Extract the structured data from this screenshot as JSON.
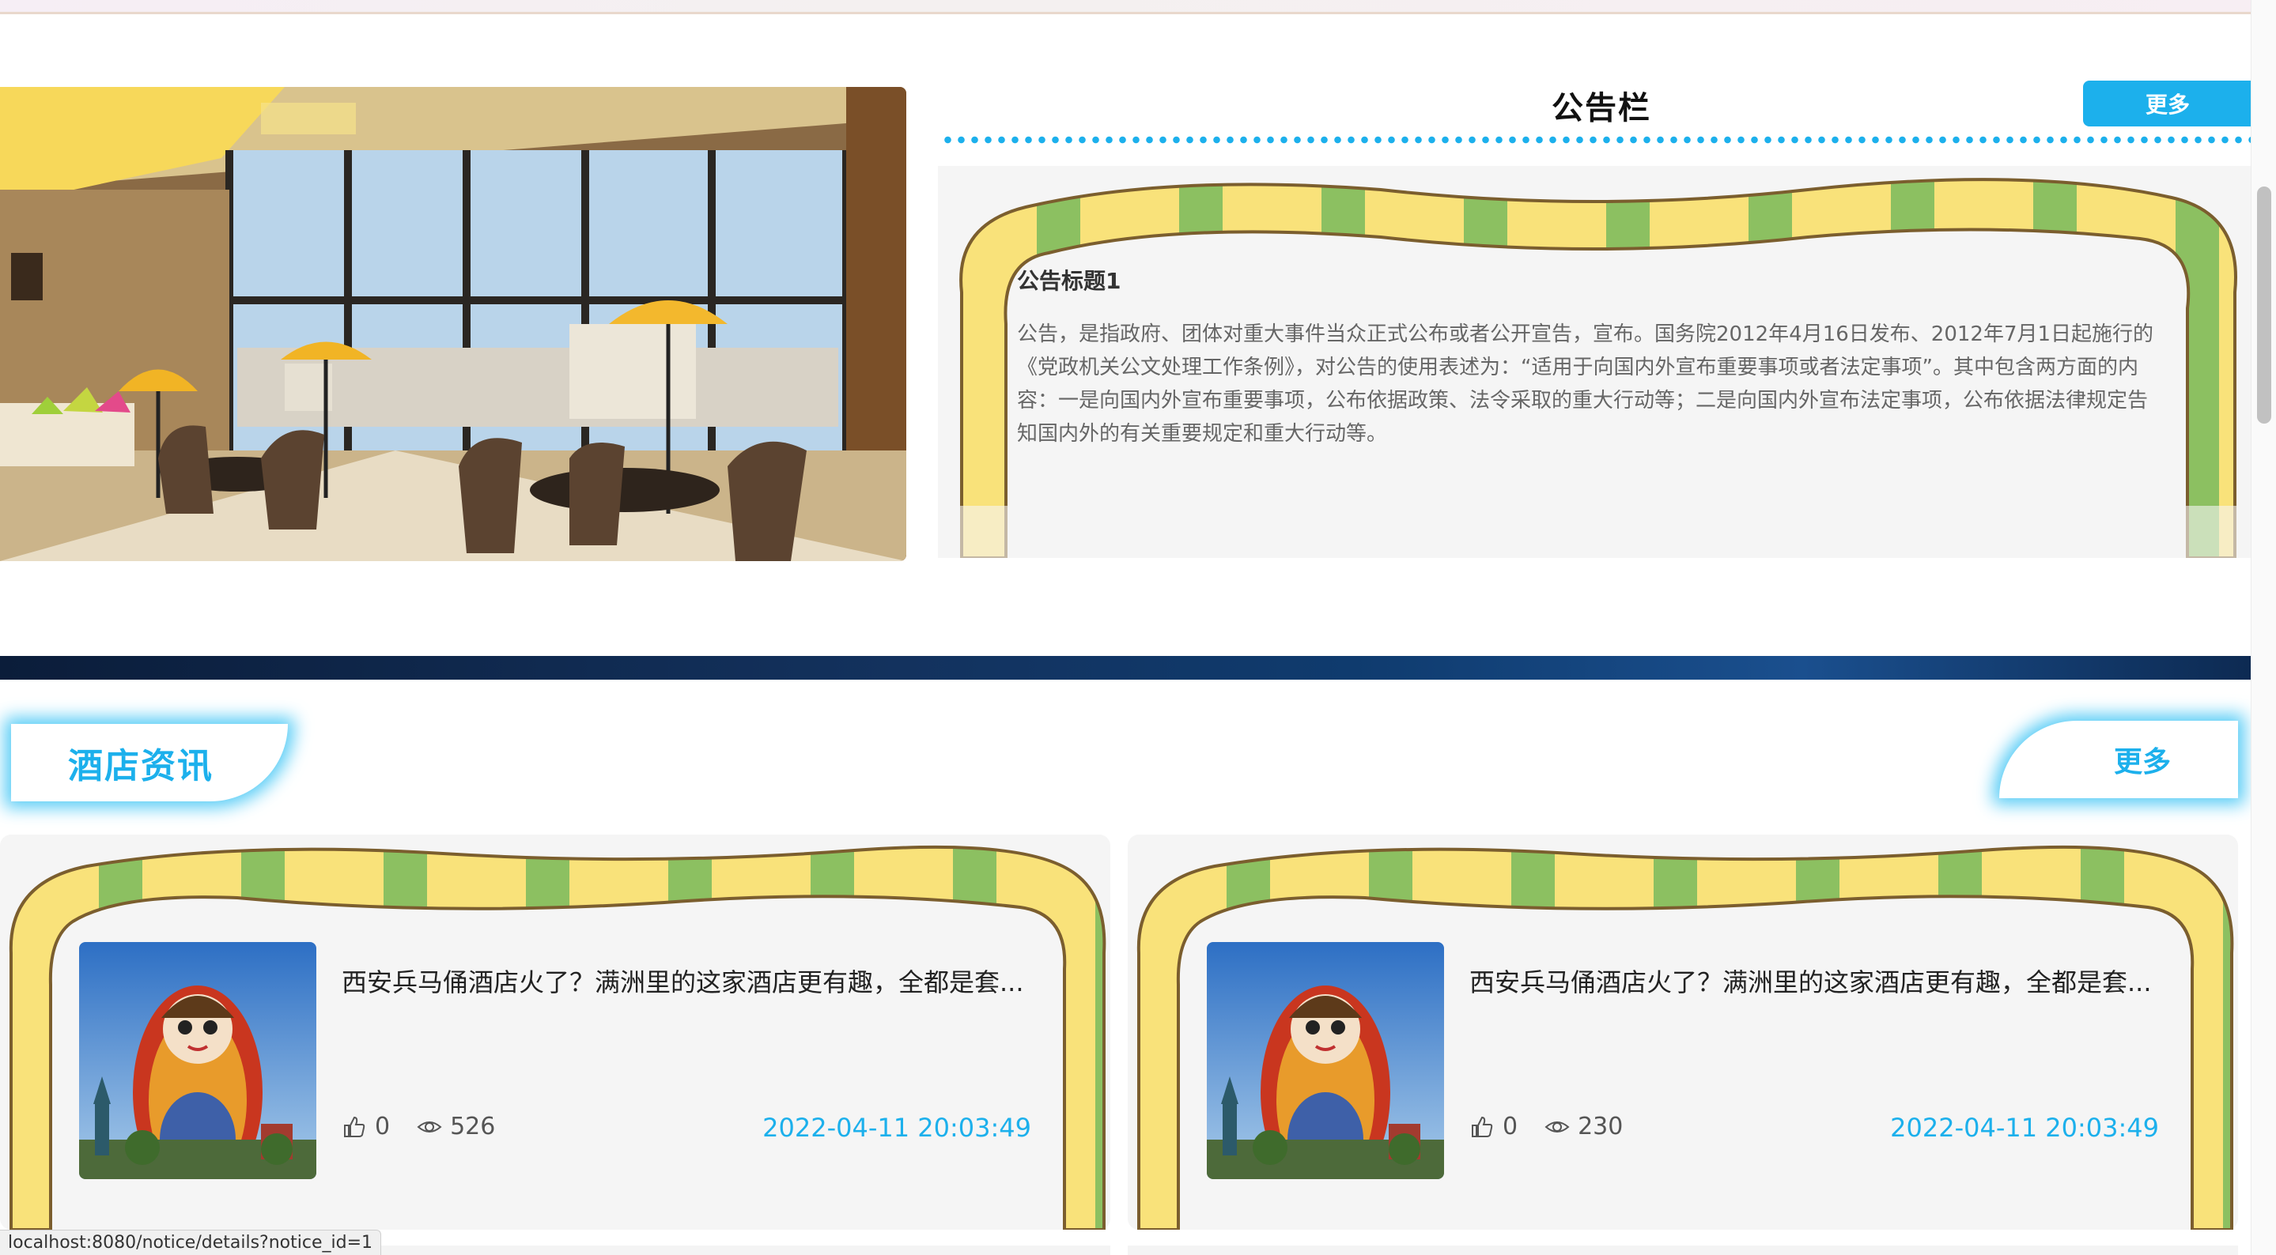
{
  "notice": {
    "heading": "公告栏",
    "more_label": "更多",
    "item_title": "公告标题1",
    "item_body": "公告，是指政府、团体对重大事件当众正式公布或者公开宣告，宣布。国务院2012年4月16日发布、2012年7月1日起施行的《党政机关公文处理工作条例》，对公告的使用表述为：“适用于向国内外宣布重要事项或者法定事项”。其中包含两方面的内容：一是向国内外宣布重要事项，公布依据政策、法令采取的重大行动等；二是向国内外宣布法定事项，公布依据法律规定告知国内外的有关重要规定和重大行动等。"
  },
  "news": {
    "section_title": "酒店资讯",
    "more_label": "更多",
    "items": [
      {
        "title": "西安兵马俑酒店火了？满洲里的这家酒店更有趣，全都是套...",
        "likes": "0",
        "views": "526",
        "date": "2022-04-11 20:03:49"
      },
      {
        "title": "西安兵马俑酒店火了？满洲里的这家酒店更有趣，全都是套...",
        "likes": "0",
        "views": "230",
        "date": "2022-04-11 20:03:49"
      }
    ]
  },
  "status_bar": {
    "url": "localhost:8080/notice/details?notice_id=1"
  },
  "icons": {
    "like": "thumbs-up-icon",
    "views": "eye-icon"
  },
  "colors": {
    "accent": "#1cb0ec",
    "frame_yellow": "#f9e27a",
    "frame_green": "#8cc061",
    "band": "#0f2c55"
  }
}
